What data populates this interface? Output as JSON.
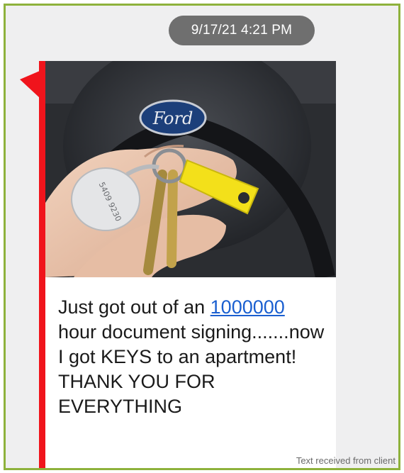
{
  "timestamp": "9/17/21 4:21 PM",
  "photo": {
    "badge_text": "Ford",
    "fob_number": "5409 9230"
  },
  "message": {
    "before_link": "Just got out of an ",
    "link_text": "1000000",
    "after_link": " hour document signing.......now I got KEYS to an apartment! THANK YOU FOR EVERYTHING"
  },
  "caption": "Text received from client",
  "colors": {
    "frame_border": "#8eb23c",
    "accent_bar": "#f0141c",
    "timestamp_pill": "#6f6f6f",
    "link": "#1a5fd0"
  }
}
